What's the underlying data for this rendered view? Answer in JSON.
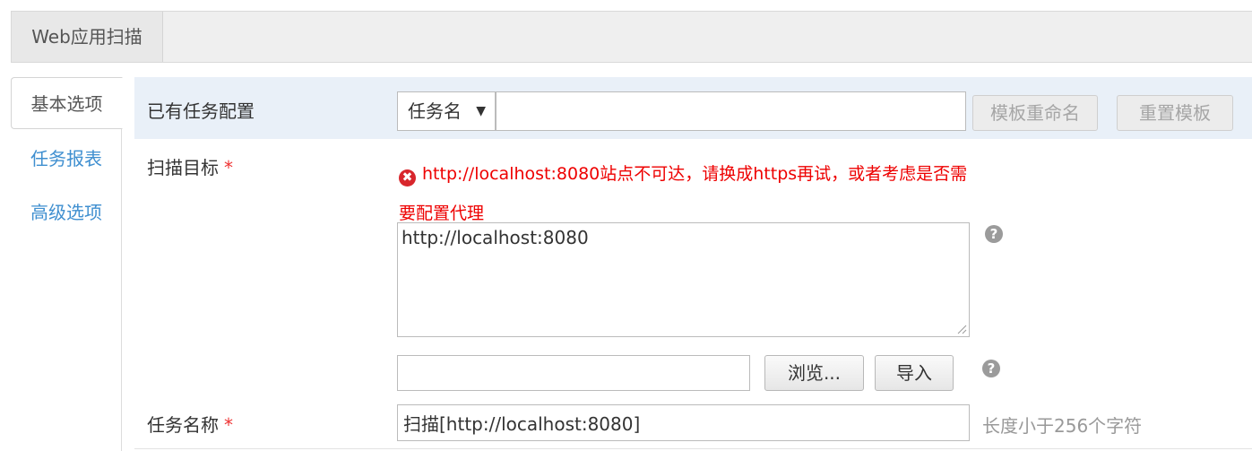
{
  "top_tab": {
    "label": "Web应用扫描"
  },
  "sidebar": {
    "items": [
      {
        "label": "基本选项",
        "active": true
      },
      {
        "label": "任务报表",
        "active": false
      },
      {
        "label": "高级选项",
        "active": false
      }
    ]
  },
  "existing_config": {
    "label": "已有任务配置",
    "select_value": "任务名",
    "select_arrow": "▼",
    "input_value": "",
    "rename_button": "模板重命名",
    "reset_button": "重置模板"
  },
  "scan_target": {
    "label": "扫描目标",
    "required_mark": "*",
    "error_icon": "✖",
    "error_text": "http://localhost:8080站点不可达，请换成https再试，或者考虑是否需要配置代理",
    "textarea_value": "http://localhost:8080",
    "help_icon": "?",
    "file_input_value": "",
    "browse_button": "浏览...",
    "import_button": "导入",
    "file_help_icon": "?"
  },
  "task_name": {
    "label": "任务名称",
    "required_mark": "*",
    "input_value": "扫描[http://localhost:8080]",
    "hint": "长度小于256个字符"
  },
  "colors": {
    "link_blue": "#3f8fd0",
    "error_red": "#e00",
    "row_highlight": "#e9f0f8"
  }
}
